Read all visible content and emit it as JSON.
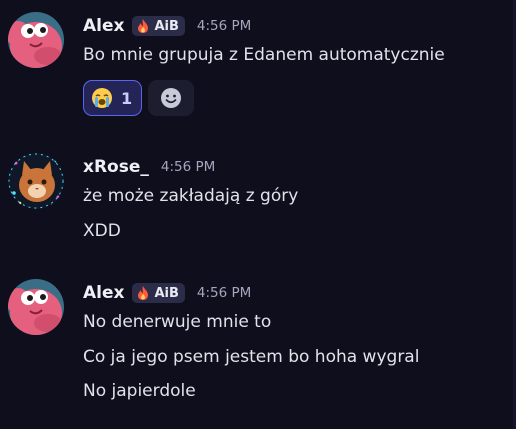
{
  "messages": [
    {
      "username": "Alex",
      "tag": "AiB",
      "time": "4:56 PM",
      "lines": [
        "Bo mnie grupuja z Edanem automatycznie"
      ],
      "reactions": [
        {
          "emoji": "loudly-crying-face",
          "count": "1",
          "active": true
        }
      ]
    },
    {
      "username": "xRose_",
      "time": "4:56 PM",
      "lines": [
        "że może zakładają z góry",
        "XDD"
      ]
    },
    {
      "username": "Alex",
      "tag": "AiB",
      "time": "4:56 PM",
      "lines": [
        "No denerwuje mnie to",
        "Co ja jego psem jestem bo hoha wygral",
        "No japierdole"
      ]
    }
  ],
  "colors": {
    "background": "#0f0e1c",
    "reaction_active_border": "#5865f2",
    "tag_background": "#2b2c47"
  }
}
